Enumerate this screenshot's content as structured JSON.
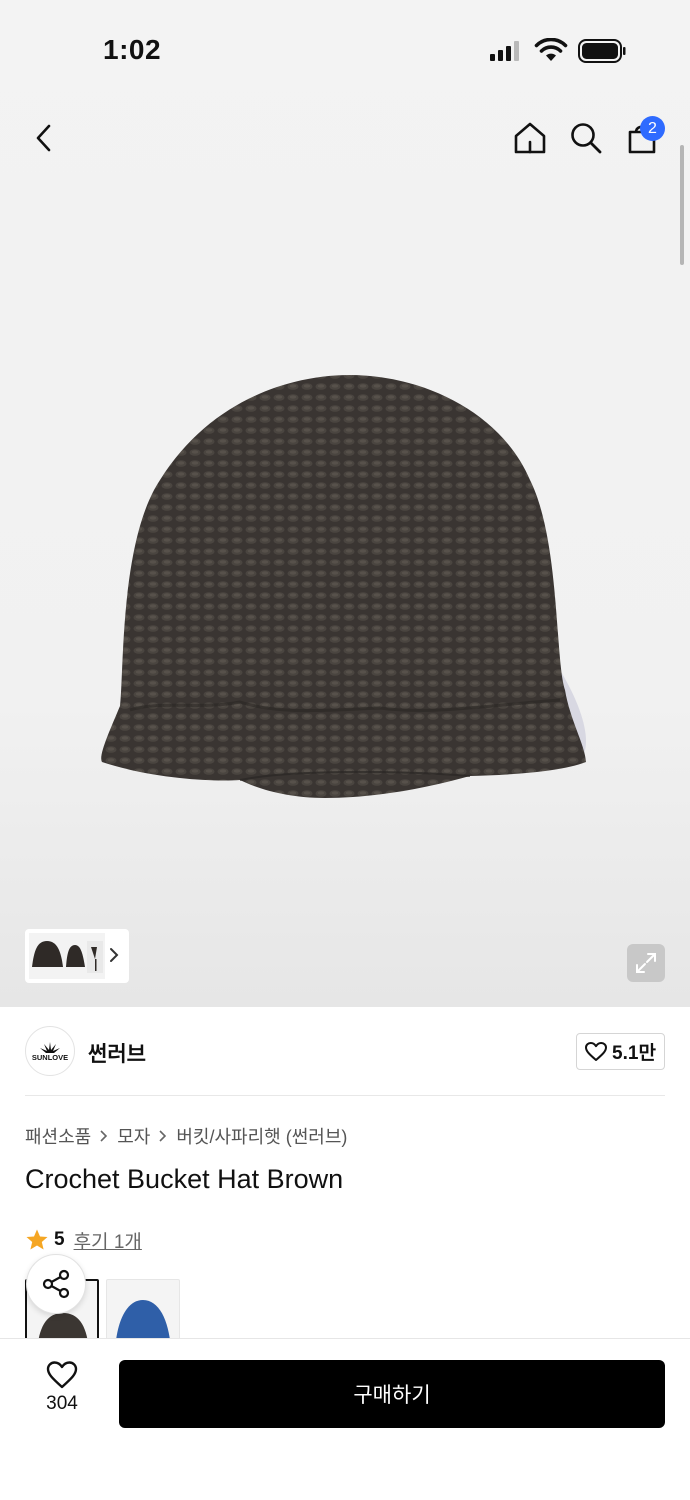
{
  "status_bar": {
    "time": "1:02"
  },
  "nav": {
    "cart_count": "2",
    "icons": [
      "back-icon",
      "home-icon",
      "search-icon",
      "bag-icon"
    ]
  },
  "brand": {
    "name": "썬러브",
    "likes": "5.1만",
    "logo_text": "SUNLOVE"
  },
  "breadcrumb": [
    "패션소품",
    "모자",
    "버킷/사파리햇 (썬러브)"
  ],
  "product": {
    "title": "Crochet Bucket Hat Brown"
  },
  "rating": {
    "score": "5",
    "reviews": "후기 1개"
  },
  "color_options": [
    {
      "name": "Brown",
      "selected": true,
      "color": "#3b3632"
    },
    {
      "name": "Blue",
      "selected": false,
      "color": "#2f5fa8"
    }
  ],
  "bottom_bar": {
    "wish_count": "304",
    "buy_label": "구매하기"
  },
  "colors": {
    "accent_badge": "#2f6bff",
    "buy_button": "#000000",
    "star": "#f5a623"
  }
}
